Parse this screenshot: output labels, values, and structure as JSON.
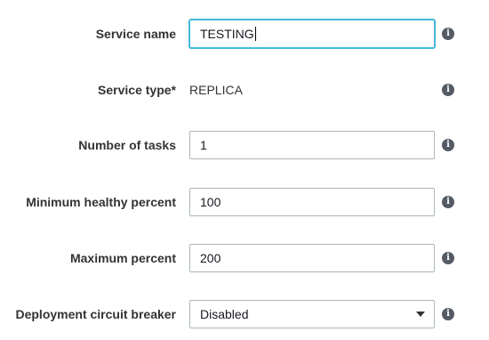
{
  "form": {
    "service_name": {
      "label": "Service name",
      "value": "TESTING",
      "info_icon": "info-icon"
    },
    "service_type": {
      "label": "Service type*",
      "value": "REPLICA",
      "info_icon": "info-icon"
    },
    "number_of_tasks": {
      "label": "Number of tasks",
      "value": "1",
      "info_icon": "info-icon"
    },
    "minimum_healthy_percent": {
      "label": "Minimum healthy percent",
      "value": "100",
      "info_icon": "info-icon"
    },
    "maximum_percent": {
      "label": "Maximum percent",
      "value": "200",
      "info_icon": "info-icon"
    },
    "deployment_circuit_breaker": {
      "label": "Deployment circuit breaker",
      "value": "Disabled",
      "dropdown_icon": "caret-down-icon",
      "info_icon": "info-icon"
    }
  },
  "colors": {
    "focus_border": "#44b9d6",
    "input_border": "#aab7b8",
    "label_text": "#333333",
    "info_icon": "#545b64"
  }
}
